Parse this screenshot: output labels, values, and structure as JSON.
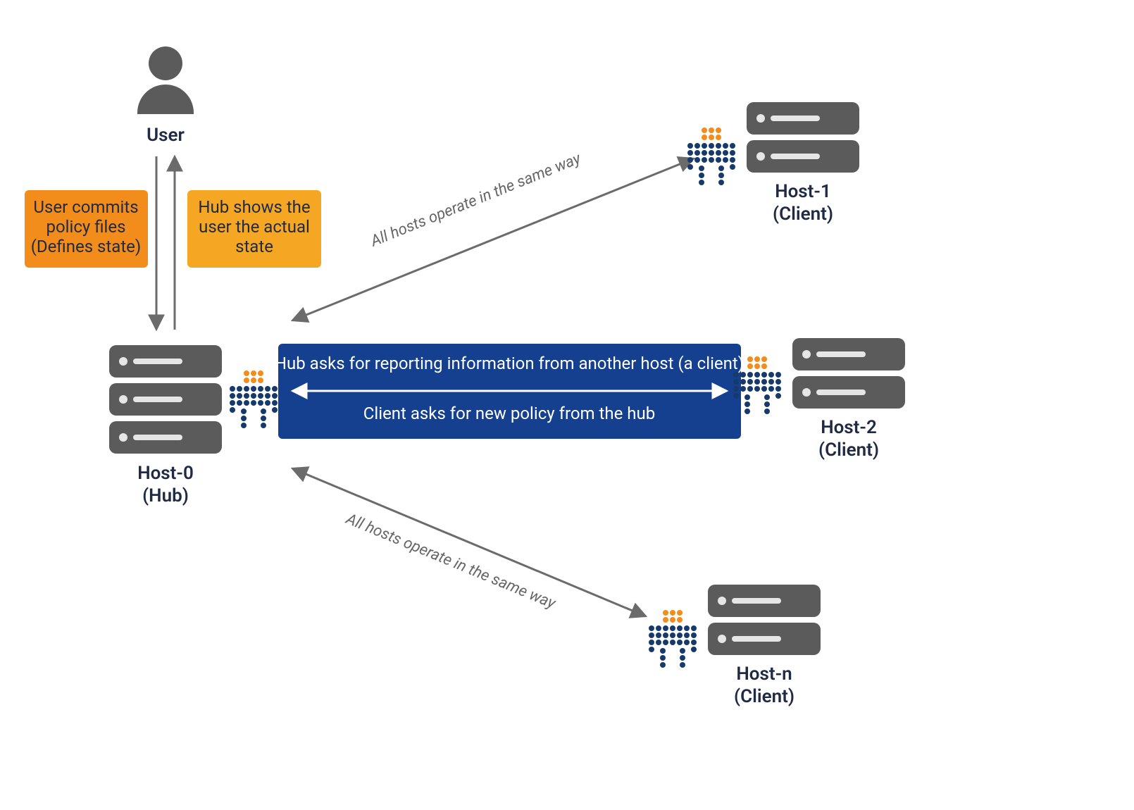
{
  "colors": {
    "orange_dark": "#F28C1B",
    "orange_light": "#F5A623",
    "blue": "#153F8F",
    "gray_dark": "#5B5B5B",
    "gray_light": "#777777",
    "navy": "#1f2a44",
    "orange_dot": "#F28C1B",
    "navy_dot": "#163A6B",
    "arrow": "#6b6b6b"
  },
  "nodes": {
    "user": {
      "label": "User"
    },
    "host0": {
      "line1": "Host-0",
      "line2": "(Hub)"
    },
    "host1": {
      "line1": "Host-1",
      "line2": "(Client)"
    },
    "host2": {
      "line1": "Host-2",
      "line2": "(Client)"
    },
    "hostn": {
      "line1": "Host-n",
      "line2": "(Client)"
    }
  },
  "callouts": {
    "left": {
      "line1": "User commits",
      "line2": "policy files",
      "line3": "(Defines state)"
    },
    "right": {
      "line1": "Hub shows the",
      "line2": "user the actual",
      "line3": "state"
    },
    "center": {
      "top": "Hub asks for reporting information from another host (a client)",
      "bottom": "Client asks for new policy from the hub"
    }
  },
  "edges": {
    "diag_top": "All hosts operate in the same way",
    "diag_bottom": "All hosts operate in the same way"
  }
}
